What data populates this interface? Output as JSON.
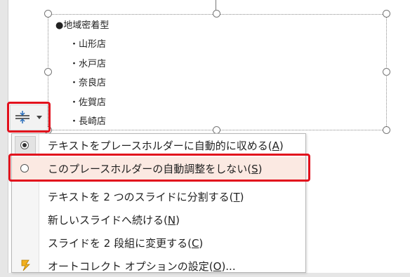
{
  "placeholder": {
    "bullet_main": "●地域密着型",
    "sub_items": [
      "・山形店",
      "・水戸店",
      "・奈良店",
      "・佐賀店",
      "・長崎店"
    ]
  },
  "autofit_button": {
    "icon": "autofit-options-icon",
    "caret_icon": "chevron-down-icon"
  },
  "menu": {
    "items": [
      {
        "label": "テキストをプレースホルダーに自動的に収める(",
        "key": "A",
        "tail": ")",
        "checked": true
      },
      {
        "label": "このプレースホルダーの自動調整をしない(",
        "key": "S",
        "tail": ")",
        "checked": false
      },
      {
        "label": "テキストを 2 つのスライドに分割する(",
        "key": "T",
        "tail": ")"
      },
      {
        "label": "新しいスライドへ続ける(",
        "key": "N",
        "tail": ")"
      },
      {
        "label": "スライドを 2 段組に変更する(",
        "key": "C",
        "tail": ")"
      },
      {
        "label": "オートコレクト オプションの設定(",
        "key": "O",
        "tail": ")..."
      }
    ],
    "autocorrect_icon": "lightning-icon"
  },
  "colors": {
    "highlight": "#e20f1c",
    "hover_bg": "#fbe9e2"
  }
}
